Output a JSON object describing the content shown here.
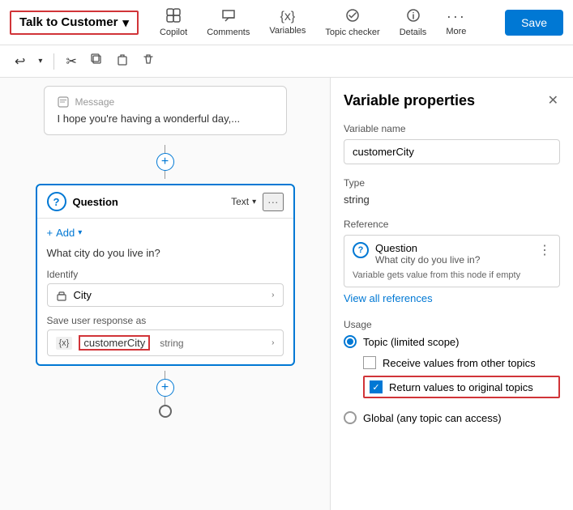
{
  "toolbar": {
    "topic_title": "Talk to Customer",
    "chevron": "▾",
    "icons": [
      {
        "name": "copilot",
        "label": "Copilot",
        "glyph": "⊕"
      },
      {
        "name": "comments",
        "label": "Comments",
        "glyph": "💬"
      },
      {
        "name": "variables",
        "label": "Variables",
        "glyph": "{x}"
      },
      {
        "name": "topic_checker",
        "label": "Topic checker",
        "glyph": "◎"
      },
      {
        "name": "details",
        "label": "Details",
        "glyph": "ℹ"
      },
      {
        "name": "more",
        "label": "More",
        "glyph": "···"
      }
    ],
    "save_label": "Save"
  },
  "sub_toolbar": {
    "undo": "↩",
    "redo_arrow": "▾",
    "cut": "✂",
    "copy": "⧉",
    "paste": "📋",
    "delete": "🗑"
  },
  "canvas": {
    "message_text": "I hope you're having a wonderful day,...",
    "add_label": "+",
    "question_node": {
      "icon": "?",
      "title": "Question",
      "text_label": "Text",
      "add_btn": "+ Add",
      "question_text": "What city do you live in?",
      "identify_label": "Identify",
      "identify_value": "City",
      "save_label": "Save user response as",
      "var_icon": "{x}",
      "var_name": "customerCity",
      "var_type": "string"
    }
  },
  "properties": {
    "title": "Variable properties",
    "close_icon": "✕",
    "var_name_label": "Variable name",
    "var_name_value": "customerCity",
    "type_label": "Type",
    "type_value": "string",
    "reference_label": "Reference",
    "reference": {
      "icon": "?",
      "title": "Question",
      "subtitle": "What city do you live in?",
      "note": "Variable gets value from this node if empty",
      "more": "⋮"
    },
    "view_all_label": "View all references",
    "usage_label": "Usage",
    "topic_scope_label": "Topic (limited scope)",
    "receive_label": "Receive values from other topics",
    "return_label": "Return values to original topics",
    "global_label": "Global (any topic can access)"
  }
}
